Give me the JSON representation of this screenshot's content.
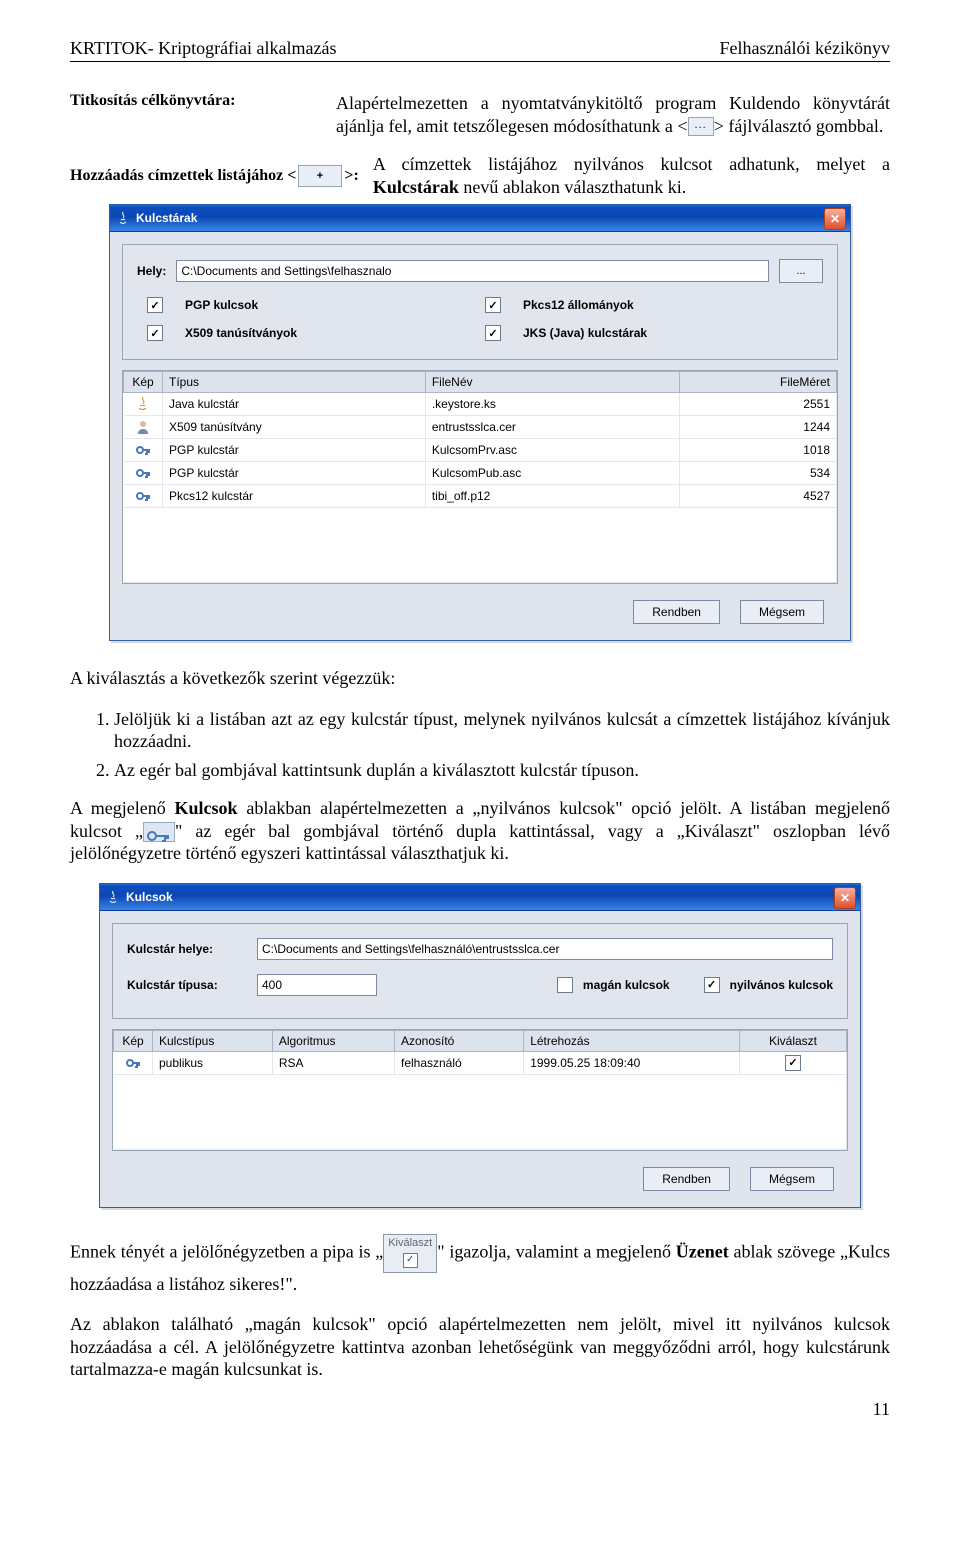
{
  "header": {
    "left": "KRTITOK- Kriptográfiai alkalmazás",
    "right": "Felhasználói kézikönyv"
  },
  "def1": {
    "term": "Titkosítás célkönyvtára:",
    "body_a": "Alapértelmezetten a nyomtatványkitöltő program Kuldendo könyvtárát ajánlja fel, amit tetszőlegesen módosíthatunk a <",
    "btn": "...",
    "body_b": "> fájlválasztó gombbal."
  },
  "def2": {
    "term_a": "Hozzáadás címzettek listájához <",
    "term_b": ">:",
    "body": "A címzettek listájához nyilvános kulcsot adhatunk, melyet a Kulcstárak nevű ablakon választhatunk ki."
  },
  "dlg1": {
    "title": "Kulcstárak",
    "hely_label": "Hely:",
    "hely_value": "C:\\Documents and Settings\\felhasznalo",
    "browse": "...",
    "chk_pgp": "PGP kulcsok",
    "chk_pkcs12": "Pkcs12 állományok",
    "chk_x509": "X509 tanúsítványok",
    "chk_jks": "JKS (Java) kulcstárak",
    "cols": {
      "kep": "Kép",
      "tipus": "Típus",
      "filenev": "FileNév",
      "filemeret": "FileMéret"
    },
    "rows": [
      {
        "tipus": "Java kulcstár",
        "file": ".keystore.ks",
        "size": "2551",
        "ico": "java"
      },
      {
        "tipus": "X509 tanúsítvány",
        "file": "entrustsslca.cer",
        "size": "1244",
        "ico": "user"
      },
      {
        "tipus": "PGP kulcstár",
        "file": "KulcsomPrv.asc",
        "size": "1018",
        "ico": "key"
      },
      {
        "tipus": "PGP kulcstár",
        "file": "KulcsomPub.asc",
        "size": "534",
        "ico": "key"
      },
      {
        "tipus": "Pkcs12 kulcstár",
        "file": "tibi_off.p12",
        "size": "4527",
        "ico": "key"
      }
    ],
    "ok": "Rendben",
    "cancel": "Mégsem"
  },
  "para_sel": "A kiválasztás a következők szerint végezzük:",
  "list": [
    "Jelöljük ki a listában azt az egy kulcstár típust, melynek nyilvános kulcsát a címzettek listájához kívánjuk hozzáadni.",
    "Az egér bal gombjával kattintsunk duplán a kiválasztott kulcstár típuson."
  ],
  "para_kulcsok_a": "A megjelenő ",
  "para_kulcsok_b": "Kulcsok",
  "para_kulcsok_c": " ablakban alapértelmezetten a „nyilvános kulcsok\" opció jelölt. A listában megjelenő kulcsot „",
  "para_kulcsok_d": "\" az egér bal gombjával történő dupla kattintással, vagy a „Kiválaszt\" oszlopban lévő jelölőnégyzetre történő egyszeri kattintással választhatjuk ki.",
  "dlg2": {
    "title": "Kulcsok",
    "label_hely": "Kulcstár helye:",
    "val_hely": "C:\\Documents and Settings\\felhasználó\\entrustsslca.cer",
    "label_tipus": "Kulcstár típusa:",
    "val_tipus": "400",
    "chk_magan": "magán kulcsok",
    "chk_nyilv": "nyilvános kulcsok",
    "cols": {
      "kep": "Kép",
      "kt": "Kulcstípus",
      "alg": "Algoritmus",
      "az": "Azonosító",
      "letre": "Létrehozás",
      "kiv": "Kiválaszt"
    },
    "row": {
      "kt": "publikus",
      "alg": "RSA",
      "az": "felhasználó",
      "letre": "1999.05.25 18:09:40"
    },
    "ok": "Rendben",
    "cancel": "Mégsem"
  },
  "para_after_a": "Ennek tényét a jelölőnégyzetben a pipa is „",
  "kivalt_label": "Kiválaszt",
  "para_after_b": "\" igazolja, valamint a megjelenő ",
  "para_after_c": "Üzenet",
  "para_after_d": " ablak szövege „Kulcs hozzáadása a listához sikeres!\".",
  "para_last": "Az ablakon található „magán kulcsok\" opció alapértelmezetten nem jelölt, mivel itt nyilvános kulcsok hozzáadása a cél. A jelölőnégyzetre kattintva azonban lehetőségünk van meggyőződni arról, hogy kulcstárunk tartalmazza-e magán kulcsunkat is.",
  "pagenum": "11"
}
